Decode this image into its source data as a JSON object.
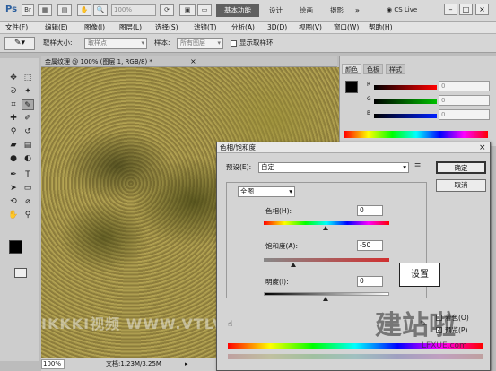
{
  "appbar": {
    "logo": "Ps",
    "zoom": "100%",
    "workspace": "基本功能",
    "tabs": [
      "设计",
      "绘画",
      "摄影"
    ],
    "more": "»",
    "cs_live": "CS Live",
    "min": "–",
    "restore": "□",
    "close": "×"
  },
  "menu": [
    "文件(F)",
    "编辑(E)",
    "图像(I)",
    "图层(L)",
    "选择(S)",
    "滤镜(T)",
    "分析(A)",
    "3D(D)",
    "视图(V)",
    "窗口(W)",
    "帮助(H)"
  ],
  "options": {
    "sample_size_label": "取样大小:",
    "sample_size_value": "取样点",
    "sample_label": "样本:",
    "sample_value": "所有图层",
    "show_ring_label": "显示取样环"
  },
  "document": {
    "tab_title": "金属纹理 @ 100% (图层 1, RGB/8) *",
    "tab_close": "×",
    "zoom": "100%",
    "doc_info": "文档:1.23M/3.25M",
    "watermark": "IKKKI视频 WWW.VTLVI.NET"
  },
  "panel": {
    "tabs": [
      "颜色",
      "色板",
      "样式"
    ],
    "channels": [
      {
        "label": "R",
        "value": "0",
        "color": "#d62020"
      },
      {
        "label": "G",
        "value": "0",
        "color": "#1faa1f"
      },
      {
        "label": "B",
        "value": "0",
        "color": "#2040d0"
      }
    ]
  },
  "dialog": {
    "title": "色相/饱和度",
    "close": "×",
    "preset_label": "预设(E):",
    "preset_value": "自定",
    "range_value": "全图",
    "hue_label": "色相(H):",
    "hue_value": "0",
    "saturation_label": "饱和度(A):",
    "saturation_value": "-50",
    "lightness_label": "明度(I):",
    "lightness_value": "0",
    "ok_label": "确定",
    "cancel_label": "取消",
    "colorize_label": "着色(O)",
    "preview_label": "预览(P)"
  },
  "callout": "设置",
  "bottom_watermark": "建站啦",
  "bottom_url": "LFXUE.com"
}
